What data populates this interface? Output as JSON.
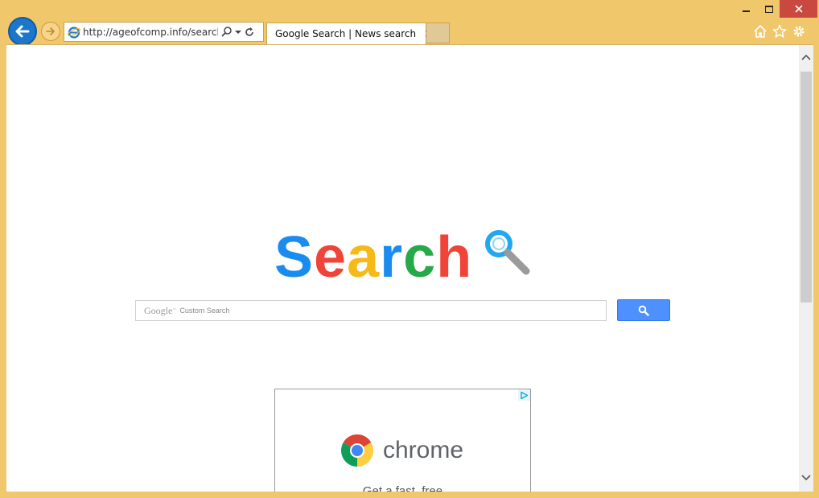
{
  "window": {
    "controls": {
      "minimize": "minimize",
      "maximize": "maximize",
      "close": "close"
    }
  },
  "nav": {
    "address": "http://ageofcomp.info/search/s",
    "back_icon": "back-arrow-icon",
    "forward_icon": "forward-arrow-icon"
  },
  "tab": {
    "title": "Google Search | News search",
    "close": "×"
  },
  "toolbar": {
    "icons": [
      "home-icon",
      "star-icon",
      "gear-icon"
    ]
  },
  "logo": {
    "letters": [
      {
        "char": "S",
        "color": "#1a8cf0"
      },
      {
        "char": "e",
        "color": "#f04438"
      },
      {
        "char": "a",
        "color": "#f7b917"
      },
      {
        "char": "r",
        "color": "#1a8cf0"
      },
      {
        "char": "c",
        "color": "#26a948"
      },
      {
        "char": "h",
        "color": "#f04438"
      }
    ]
  },
  "search": {
    "placeholder_brand": "Google",
    "placeholder_tm": "™",
    "placeholder_label": "Custom Search",
    "button_color": "#4d90fe"
  },
  "ad": {
    "brand": "chrome",
    "tagline": "Get a fast, free"
  }
}
